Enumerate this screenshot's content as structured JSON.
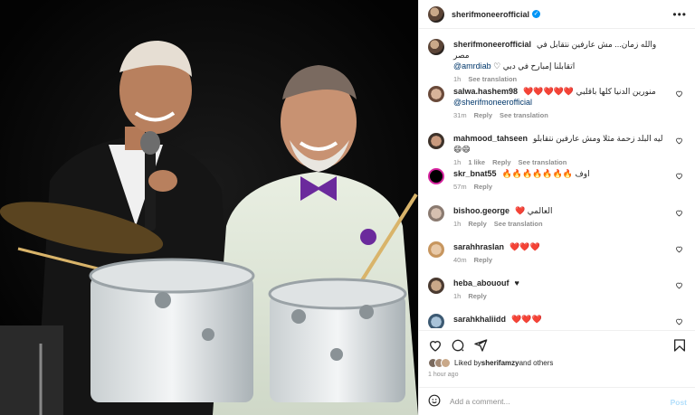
{
  "post": {
    "username": "sherifmoneerofficial",
    "verified": true,
    "more_icon": "more-icon"
  },
  "caption": {
    "username": "sherifmoneerofficial",
    "text": "والله زمان... مش عارفين نتقابل في مصر",
    "text2": "اتقابلنا إمبارح في دبي ♡",
    "tag": "@amrdiab",
    "time": "1h",
    "see_translation": "See translation"
  },
  "comments": [
    {
      "username": "salwa.hashem98",
      "text": "منورين الدنيا كلها باقلبي ❤️❤️❤️❤️❤️",
      "tag": "@sherifmoneerofficial",
      "time": "31m",
      "reply": "Reply",
      "see_translation": "See translation"
    },
    {
      "username": "mahmood_tahseen",
      "text": "ليه البلد زحمة مثلا ومش عارفين نتقابلو 😄😄",
      "time": "1h",
      "likes": "1 like",
      "reply": "Reply",
      "see_translation": "See translation"
    },
    {
      "username": "skr_bnat55",
      "text": "اوف 🔥🔥🔥🔥🔥🔥🔥",
      "time": "57m",
      "reply": "Reply"
    },
    {
      "username": "bishoo.george",
      "text": "العالمي ❤️",
      "time": "1h",
      "reply": "Reply",
      "see_translation": "See translation"
    },
    {
      "username": "sarahhraslan",
      "text": "❤️❤️❤️",
      "time": "40m",
      "reply": "Reply"
    },
    {
      "username": "heba_abououf",
      "text": "♥",
      "time": "1h",
      "reply": "Reply"
    },
    {
      "username": "sarahkhaliidd",
      "text": "❤️❤️❤️",
      "time": "",
      "reply": ""
    }
  ],
  "likes": {
    "prefix": "Liked by ",
    "user": "sherifamzy",
    "suffix": " and others"
  },
  "timestamp": "1 hour ago",
  "add_comment": {
    "placeholder": "Add a comment...",
    "post_label": "Post"
  },
  "colors": {
    "link": "#00376b",
    "heart_red": "#ed4956",
    "post_disabled": "#b2dffc",
    "verified": "#0095f6"
  }
}
